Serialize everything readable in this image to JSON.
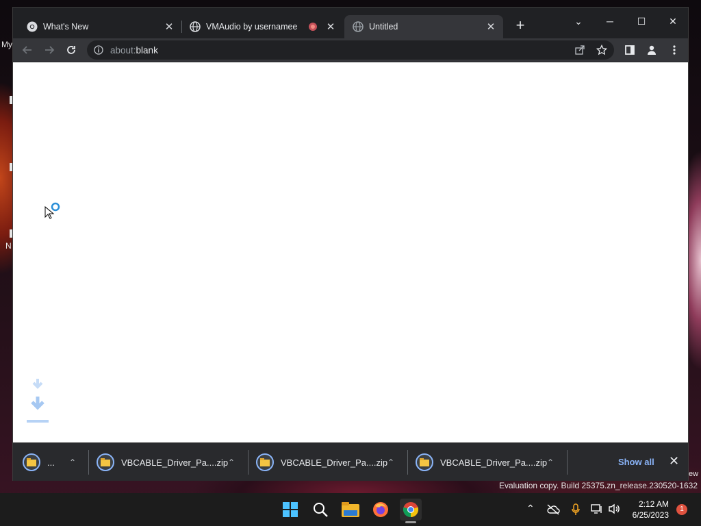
{
  "desktop": {
    "label_my": "My",
    "label_n": "N",
    "label_ew": "ew",
    "watermark": "Evaluation copy. Build 25375.zn_release.230520-1632"
  },
  "tabs": [
    {
      "title": "What's New",
      "close": "✕"
    },
    {
      "title": "VMAudio by usernamee",
      "close": "✕"
    },
    {
      "title": "Untitled",
      "close": "✕"
    }
  ],
  "new_tab": "+",
  "window_controls": {
    "tab_search": "⌄",
    "minimize": "─",
    "maximize": "☐",
    "close": "✕"
  },
  "omnibox": {
    "scheme": "about:",
    "page": "blank"
  },
  "downloads": {
    "items": [
      {
        "name": "..."
      },
      {
        "name": "VBCABLE_Driver_Pa....zip"
      },
      {
        "name": "VBCABLE_Driver_Pa....zip"
      },
      {
        "name": "VBCABLE_Driver_Pa....zip"
      }
    ],
    "show_all": "Show all",
    "close": "✕"
  },
  "taskbar": {
    "time": "2:12 AM",
    "date": "6/25/2023",
    "notifications": "1"
  },
  "colors": {
    "accent": "#8ab4f8",
    "chrome_bg": "#202124",
    "toolbar_bg": "#35363a"
  }
}
